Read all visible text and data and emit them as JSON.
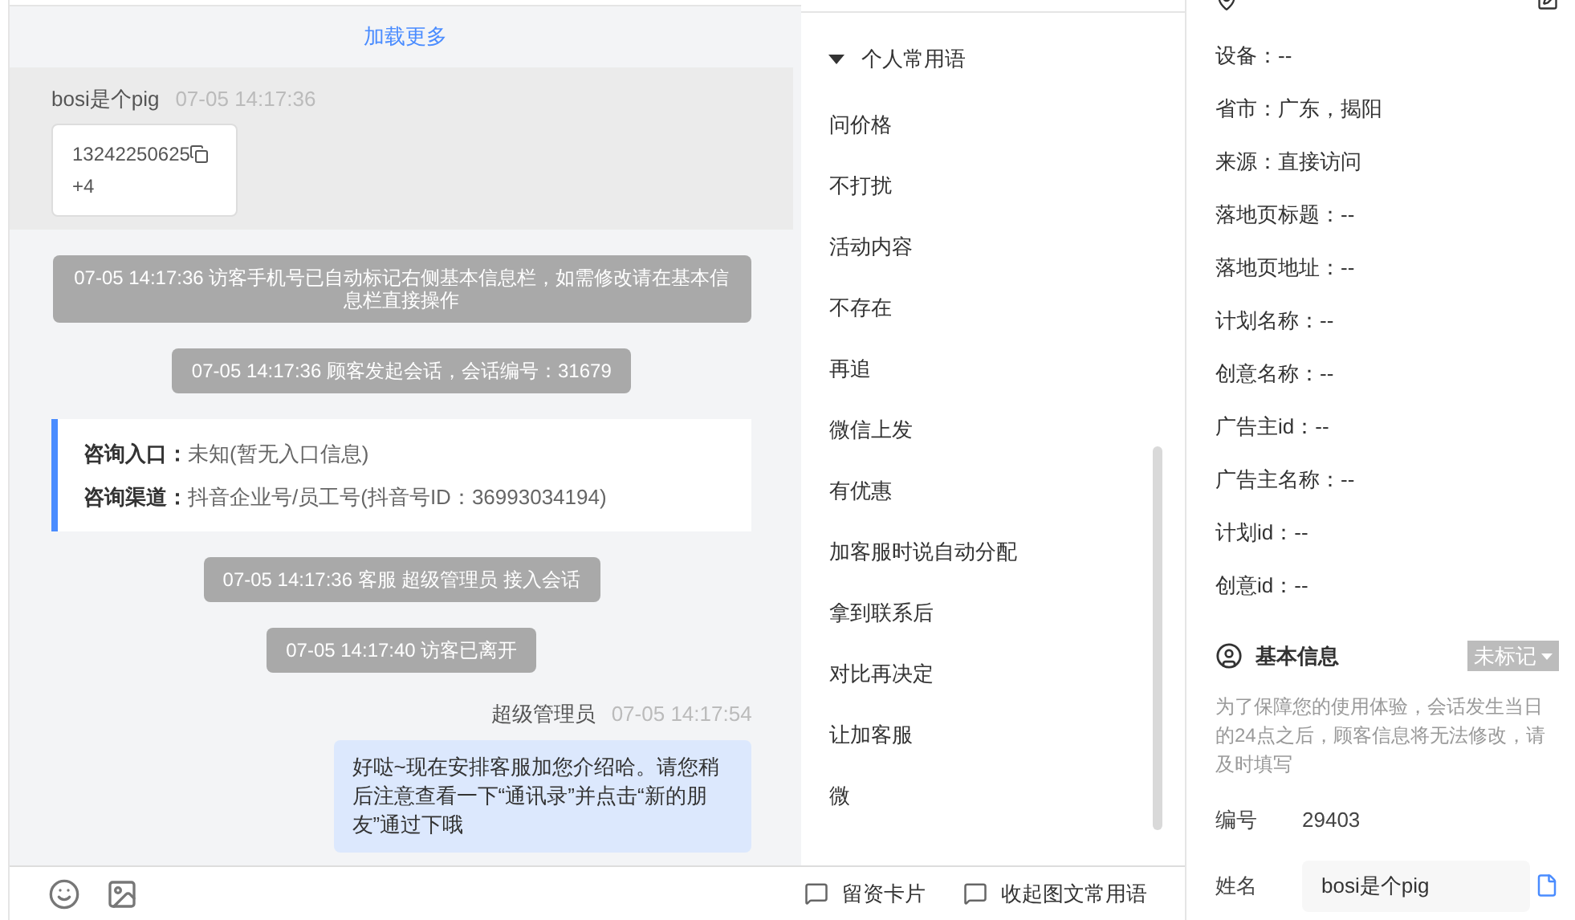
{
  "chat": {
    "load_more": "加载更多",
    "messages": [
      {
        "kind": "visitor",
        "sender": "bosi是个pig",
        "time": "07-05 14:17:36",
        "phone": "13242250625",
        "extra": "+4"
      },
      {
        "kind": "system",
        "text": "07-05 14:17:36 访客手机号已自动标记右侧基本信息栏，如需修改请在基本信息栏直接操作"
      },
      {
        "kind": "system",
        "text": "07-05 14:17:36 顾客发起会话，会话编号：31679"
      },
      {
        "kind": "info",
        "rows": [
          {
            "label": "咨询入口：",
            "value": "未知(暂无入口信息)"
          },
          {
            "label": "咨询渠道：",
            "value": "抖音企业号/员工号(抖音号ID：36993034194)"
          }
        ]
      },
      {
        "kind": "system",
        "text": "07-05 14:17:36 客服 超级管理员 接入会话"
      },
      {
        "kind": "system",
        "text": "07-05 14:17:40 访客已离开"
      },
      {
        "kind": "agent",
        "sender": "超级管理员",
        "time": "07-05 14:17:54",
        "text": "好哒~现在安排客服加您介绍哈。请您稍后注意查看一下“通讯录”并点击“新的朋友”通过下哦"
      }
    ]
  },
  "phrases": {
    "group": "个人常用语",
    "expanded": true,
    "items": [
      "问价格",
      "不打扰",
      "活动内容",
      "不存在",
      "再追",
      "微信上发",
      "有优惠",
      "加客服时说自动分配",
      "拿到联系后",
      "对比再决定",
      "让加客服",
      "微"
    ]
  },
  "toolbar": [
    "留资卡片",
    "收起图文常用语"
  ],
  "source_info": [
    "设备：--",
    "省市：广东，揭阳",
    "来源：直接访问",
    "落地页标题：--",
    "落地页地址：--",
    "计划名称：--",
    "创意名称：--",
    "广告主id：--",
    "广告主名称：--",
    "计划id：--",
    "创意id：--"
  ],
  "basic_info": {
    "title": "基本信息",
    "tag": "未标记",
    "notice": "为了保障您的使用体验，会话发生当日的24点之后，顾客信息将无法修改，请及时填写",
    "fields": [
      {
        "kind": "text",
        "label": "编号",
        "value": "29403"
      },
      {
        "kind": "input",
        "label": "姓名",
        "value": "bosi是个pig"
      }
    ]
  }
}
